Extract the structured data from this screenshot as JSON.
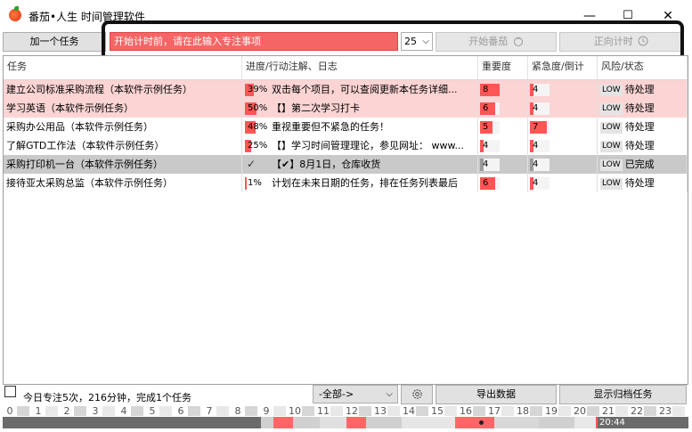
{
  "window": {
    "title": "番茄•人生 时间管理软件",
    "minimize_glyph": "—",
    "maximize_glyph": "☐",
    "close_glyph": "✕"
  },
  "toolbar": {
    "add_task_label": "加一个任务",
    "focus_placeholder": "开始计时前，请在此输入专注事项",
    "minutes_value": "25",
    "minutes_arrow": "⌵",
    "start_tomato_label": "开始番茄",
    "forward_timer_label": "正向计时"
  },
  "table": {
    "headers": [
      "任务",
      "进度/行动注解、日志",
      "重要度",
      "紧急度/倒计",
      "风险/状态"
    ],
    "rows": [
      {
        "task": "建立公司标准采购流程（本软件示例任务）",
        "progress": "39%",
        "progress_value": 39,
        "note": "双击每个项目，可以查阅更新本任务详细...",
        "importance": "8",
        "importance_value": 8,
        "urgency": "4",
        "urgency_value": 4,
        "risk": "LOW",
        "status": "待处理",
        "style": "pink"
      },
      {
        "task": "学习英语（本软件示例任务）",
        "progress": "50%",
        "progress_value": 50,
        "note": "【】第二次学习打卡",
        "importance": "6",
        "importance_value": 6,
        "urgency": "4",
        "urgency_value": 4,
        "risk": "LOW",
        "status": "待处理",
        "style": "pink"
      },
      {
        "task": "采购办公用品（本软件示例任务）",
        "progress": "48%",
        "progress_value": 48,
        "note": "重视重要但不紧急的任务！",
        "importance": "5",
        "importance_value": 5,
        "urgency": "7",
        "urgency_value": 7,
        "risk": "LOW",
        "status": "待处理",
        "style": "white"
      },
      {
        "task": "了解GTD工作法（本软件示例任务）",
        "progress": "25%",
        "progress_value": 25,
        "note": "【】学习时间管理理论，参见网址： www...",
        "importance": "4",
        "importance_value": 4,
        "urgency": "4",
        "urgency_value": 4,
        "risk": "LOW",
        "status": "待处理",
        "style": "white"
      },
      {
        "task": "采购打印机一台（本软件示例任务）",
        "progress": "✓",
        "progress_value": 100,
        "note": "【✔】8月1日，仓库收货",
        "importance": "4",
        "importance_value": 4,
        "urgency": "4",
        "urgency_value": 4,
        "risk": "LOW",
        "status": "已完成",
        "style": "gray"
      },
      {
        "task": "接待亚太采购总监（本软件示例任务）",
        "progress": "1%",
        "progress_value": 1,
        "note": "计划在未来日期的任务，排在任务列表最后",
        "importance": "6",
        "importance_value": 6,
        "urgency": "4",
        "urgency_value": 4,
        "risk": "LOW",
        "status": "待处理",
        "style": "white"
      }
    ]
  },
  "footer": {
    "stats_text": "今日专注5次，216分钟，完成1个任务",
    "filter_value": "-全部->",
    "filter_arrow": "⌵",
    "settings_icon": "gear-icon",
    "export_label": "导出数据",
    "archive_label": "显示归档任务"
  },
  "timeline": {
    "hours": [
      "0",
      "1",
      "2",
      "3",
      "4",
      "5",
      "6",
      "7",
      "8",
      "9",
      "10",
      "11",
      "12",
      "13",
      "14",
      "15",
      "16",
      "17",
      "18",
      "19",
      "20",
      "21",
      "22",
      "23"
    ],
    "current_time": "20:44"
  },
  "colors": {
    "accent_red": "#f55555",
    "pink_row": "#fcd4d4",
    "gray_row": "#c9c9c9",
    "frame": "#111111"
  }
}
